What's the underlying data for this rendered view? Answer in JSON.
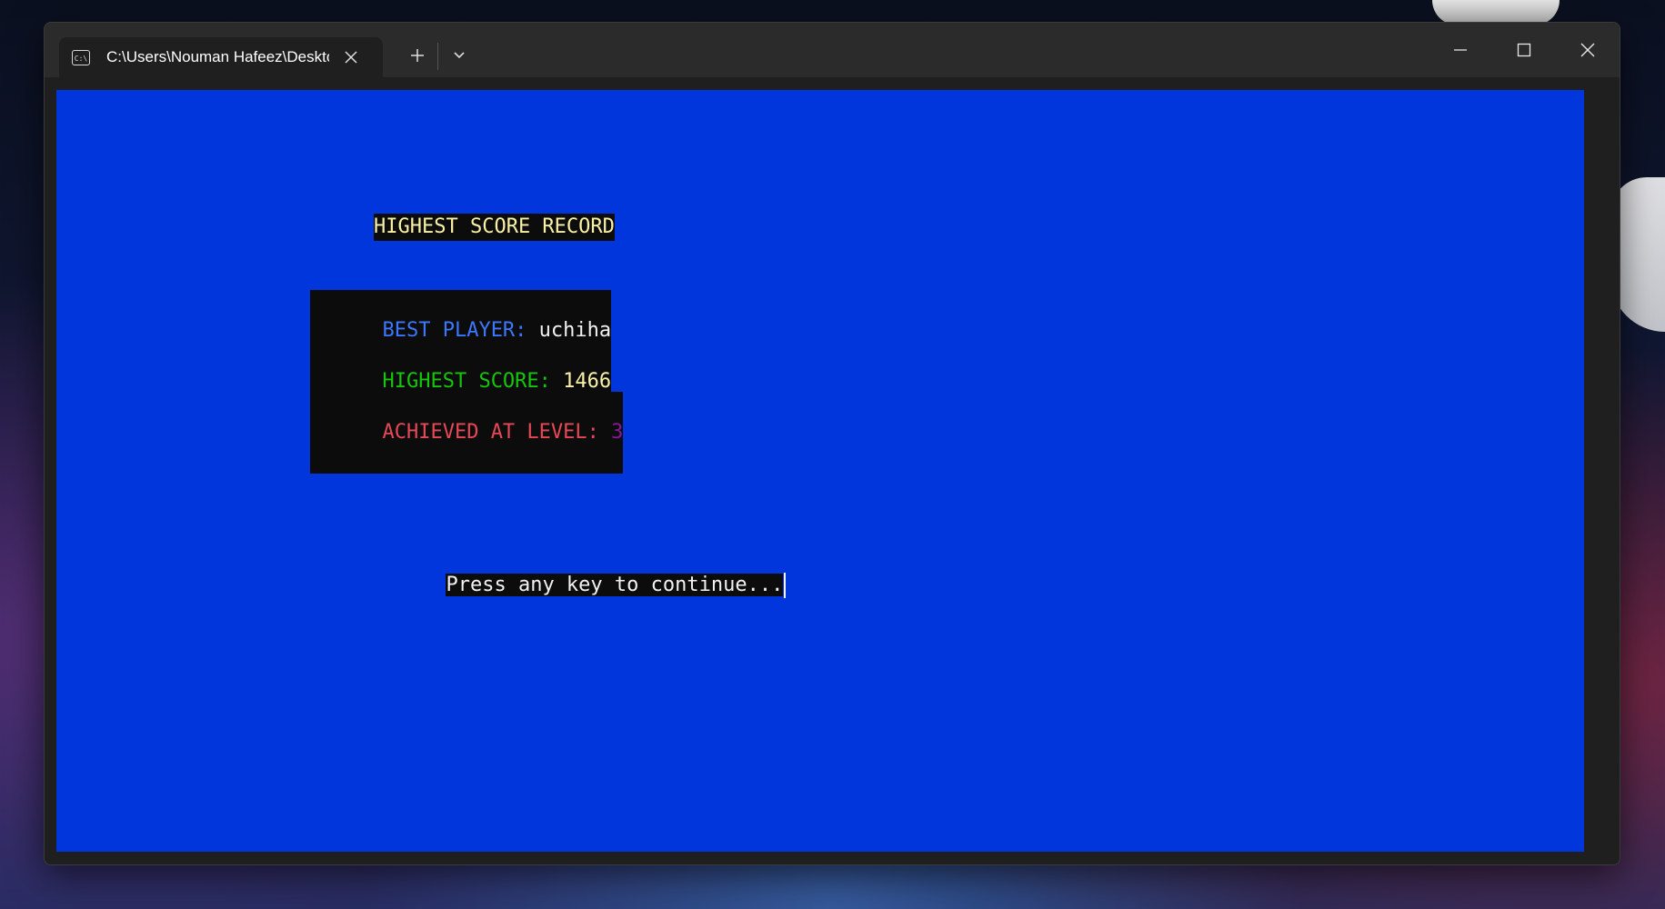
{
  "window": {
    "tab_title": "C:\\Users\\Nouman Hafeez\\Desktop",
    "tab_icon": "cmd-icon",
    "new_tab_glyph": "+",
    "close_tab_glyph": "✕"
  },
  "colors": {
    "console_background": "#0036dc",
    "highlight": "#0c0c0c",
    "yellow": "#f9f1a5",
    "blue": "#3b78ff",
    "green": "#16c60c",
    "red": "#e74856",
    "purple": "#881798",
    "white": "#f2f2f2"
  },
  "console": {
    "heading": "HIGHEST SCORE RECORD",
    "best_player_label": "BEST PLAYER: ",
    "best_player_value": "uchiha",
    "highest_score_label": "HIGHEST SCORE: ",
    "highest_score_value": "1466",
    "level_label": "ACHIEVED AT LEVEL: ",
    "level_value": "3",
    "prompt": "Press any key to continue..."
  }
}
